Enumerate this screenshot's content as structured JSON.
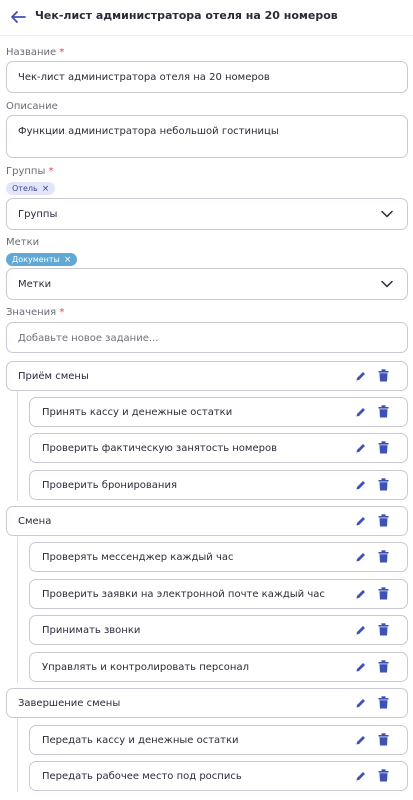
{
  "header": {
    "title": "Чек-лист администратора отеля на 20 номеров"
  },
  "fields": {
    "name": {
      "label": "Название",
      "required_mark": "*",
      "value": "Чек-лист администратора отеля на 20 номеров"
    },
    "description": {
      "label": "Описание",
      "value": "Функции администратора небольшой гостиницы"
    },
    "groups": {
      "label": "Группы",
      "required_mark": "*",
      "chip": "Отель",
      "select_placeholder": "Группы"
    },
    "tags": {
      "label": "Метки",
      "chip": "Документы",
      "select_placeholder": "Метки"
    },
    "values": {
      "label": "Значения",
      "required_mark": "*",
      "input_placeholder": "Добавьте новое задание..."
    }
  },
  "chip_remove": "×",
  "tasks": [
    {
      "label": "Приём смены",
      "children": [
        "Принять кассу и денежные остатки",
        "Проверить фактическую занятость номеров",
        "Проверить бронирования"
      ]
    },
    {
      "label": "Смена",
      "children": [
        "Проверять мессенджер каждый час",
        "Проверить заявки на электронной почте каждый час",
        "Принимать звонки",
        "Управлять и контролировать персонал"
      ]
    },
    {
      "label": "Завершение смены",
      "children": [
        "Передать кассу и денежные остатки",
        "Передать рабочее место под роспись"
      ]
    }
  ],
  "colors": {
    "accent": "#3f51b5",
    "chip_group_bg": "#e3e6fa",
    "chip_tag_bg": "#5fa9d4",
    "required": "#e0434f"
  }
}
